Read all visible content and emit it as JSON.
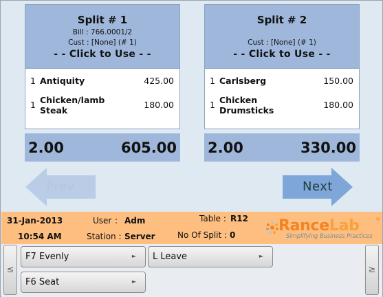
{
  "splits": [
    {
      "title": "Split # 1",
      "bill": "Bill : 766.0001/2",
      "cust": "Cust : [None] (# 1)",
      "click_label": "- - Click to Use - -",
      "items": [
        {
          "qty": "1",
          "name": "Antiquity",
          "amount": "425.00"
        },
        {
          "qty": "1",
          "name": "Chicken/lamb Steak",
          "amount": "180.00"
        }
      ],
      "total_qty": "2.00",
      "total_amount": "605.00"
    },
    {
      "title": "Split # 2",
      "bill": "",
      "cust": "Cust : [None] (# 1)",
      "click_label": "- - Click to Use - -",
      "items": [
        {
          "qty": "1",
          "name": "Carlsberg",
          "amount": "150.00"
        },
        {
          "qty": "1",
          "name": "Chicken Drumsticks",
          "amount": "180.00"
        }
      ],
      "total_qty": "2.00",
      "total_amount": "330.00"
    }
  ],
  "nav": {
    "prev_label": "Prev",
    "next_label": "Next",
    "prev_enabled": false,
    "next_enabled": true
  },
  "status": {
    "date": "31-Jan-2013",
    "time": "10:54 AM",
    "user_label": "User",
    "user_value": "Adm",
    "station_label": "Station :",
    "station_value": "Server",
    "table_label": "Table :",
    "table_value": "R12",
    "split_count_label": "No Of Split :",
    "split_count_value": "0",
    "colon": ":"
  },
  "logo": {
    "name_part1": "Rance",
    "name_part2": "Lab",
    "registered": "®",
    "tagline": "Simplifying Business Practices"
  },
  "function_keys": [
    {
      "label": "F7 Evenly",
      "icon": "triangle-right-icon"
    },
    {
      "label": "L Leave",
      "icon": "triangle-right-icon"
    },
    {
      "label": "F6 Seat",
      "icon": "triangle-right-icon"
    }
  ],
  "scroll": {
    "left_glyph": "≤",
    "right_glyph": "≥"
  },
  "colors": {
    "card_header": "#9fb7db",
    "status_bar": "#fdbe80",
    "background": "#dfe9f1",
    "logo_orange": "#f28423"
  }
}
